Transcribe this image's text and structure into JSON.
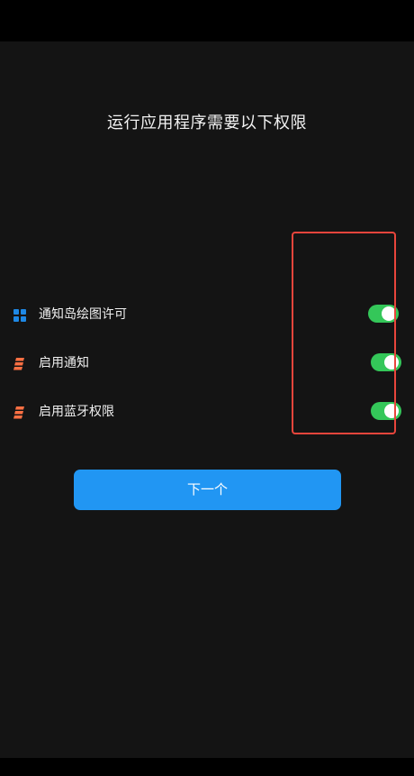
{
  "header": {
    "title": "运行应用程序需要以下权限"
  },
  "permissions": [
    {
      "label": "通知岛绘图许可",
      "icon": "grid-icon",
      "enabled": true
    },
    {
      "label": "启用通知",
      "icon": "stack-icon",
      "enabled": true
    },
    {
      "label": "启用蓝牙权限",
      "icon": "stack-icon",
      "enabled": true
    }
  ],
  "actions": {
    "next_label": "下一个"
  },
  "colors": {
    "background": "#141414",
    "toggle_on": "#34c759",
    "primary_button": "#2196f3",
    "highlight": "#e8453c",
    "icon_blue": "#1e88e5",
    "icon_orange": "#ff7043"
  }
}
